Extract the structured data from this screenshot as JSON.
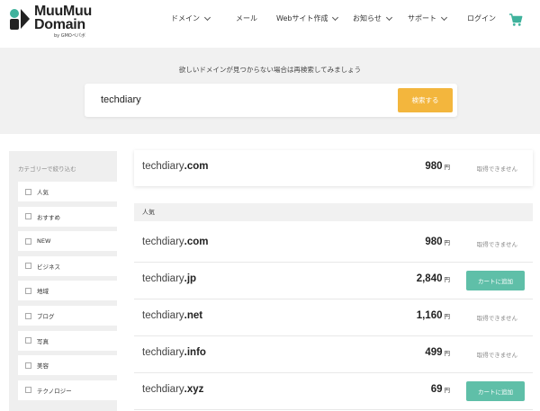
{
  "logo": {
    "line1": "MuuMuu",
    "line2": "Domain",
    "sub": "by GMOペパボ"
  },
  "nav": [
    {
      "label": "ドメイン",
      "chevron": true
    },
    {
      "label": "メール",
      "chevron": false
    },
    {
      "label": "Webサイト作成",
      "chevron": true
    },
    {
      "label": "お知らせ",
      "chevron": true
    },
    {
      "label": "サポート",
      "chevron": true
    },
    {
      "label": "ログイン",
      "chevron": false
    }
  ],
  "cart_icon": "cart-icon",
  "search": {
    "hint": "欲しいドメインが見つからない場合は再検索してみましょう",
    "value": "techdiary",
    "button": "検索する"
  },
  "sidebar": {
    "title": "カテゴリーで絞り込む",
    "categories": [
      "人気",
      "おすすめ",
      "NEW",
      "ビジネス",
      "地域",
      "ブログ",
      "写真",
      "美容",
      "テクノロジー"
    ]
  },
  "results": {
    "top": {
      "name": "techdiary",
      "tld": ".com",
      "price": "980",
      "unit": "円",
      "status": "取得できません"
    },
    "section_title": "人気",
    "rows": [
      {
        "name": "techdiary",
        "tld": ".com",
        "price": "980",
        "unit": "円",
        "status": "取得できません",
        "available": false
      },
      {
        "name": "techdiary",
        "tld": ".jp",
        "price": "2,840",
        "unit": "円",
        "status": "カートに追加",
        "available": true
      },
      {
        "name": "techdiary",
        "tld": ".net",
        "price": "1,160",
        "unit": "円",
        "status": "取得できません",
        "available": false
      },
      {
        "name": "techdiary",
        "tld": ".info",
        "price": "499",
        "unit": "円",
        "status": "取得できません",
        "available": false
      },
      {
        "name": "techdiary",
        "tld": ".xyz",
        "price": "69",
        "unit": "円",
        "status": "カートに追加",
        "available": true
      }
    ]
  },
  "colors": {
    "accent_search": "#f3b63d",
    "accent_add": "#5fbfa8",
    "cart": "#3fb29c",
    "logo_mark": "#3fb29c"
  }
}
